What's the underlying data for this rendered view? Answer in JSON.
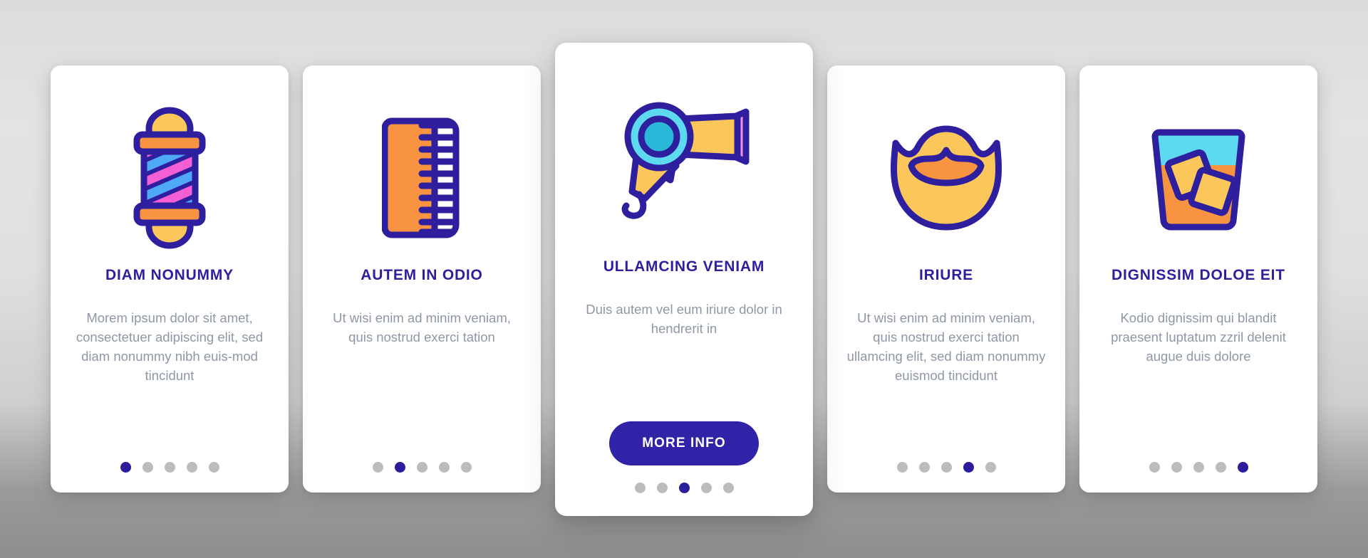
{
  "theme": {
    "accent": "#2e1f9e",
    "button_bg": "#3023a8",
    "body_text": "#8e98a4",
    "dot_inactive": "#bcbcbc",
    "dot_active": "#2b1d9c",
    "card_bg": "#ffffff",
    "page_bg": "#dcdcdc"
  },
  "cards": [
    {
      "icon": "barber-pole-icon",
      "title": "DIAM NONUMMY",
      "body": "Morem ipsum dolor sit amet, consectetuer adipiscing elit, sed diam nonummy nibh euis-mod tincidunt",
      "dots": {
        "count": 5,
        "active": 1
      },
      "featured": false
    },
    {
      "icon": "hair-comb-icon",
      "title": "AUTEM IN ODIO",
      "body": "Ut wisi enim ad minim veniam, quis nostrud exerci tation",
      "dots": {
        "count": 5,
        "active": 2
      },
      "featured": false
    },
    {
      "icon": "hair-dryer-icon",
      "title": "ULLAMCING VENIAM",
      "body": "Duis autem vel eum iriure dolor in hendrerit in",
      "button_label": "MORE INFO",
      "dots": {
        "count": 5,
        "active": 3
      },
      "featured": true
    },
    {
      "icon": "beard-icon",
      "title": "IRIURE",
      "body": "Ut wisi enim ad minim veniam, quis nostrud exerci tation ullamcing elit, sed diam nonummy euismod tincidunt",
      "dots": {
        "count": 5,
        "active": 4
      },
      "featured": false
    },
    {
      "icon": "whiskey-glass-icon",
      "title": "DIGNISSIM DOLOE EIT",
      "body": "Kodio dignissim qui blandit praesent luptatum zzril delenit augue duis dolore",
      "dots": {
        "count": 5,
        "active": 5
      },
      "featured": false
    }
  ]
}
